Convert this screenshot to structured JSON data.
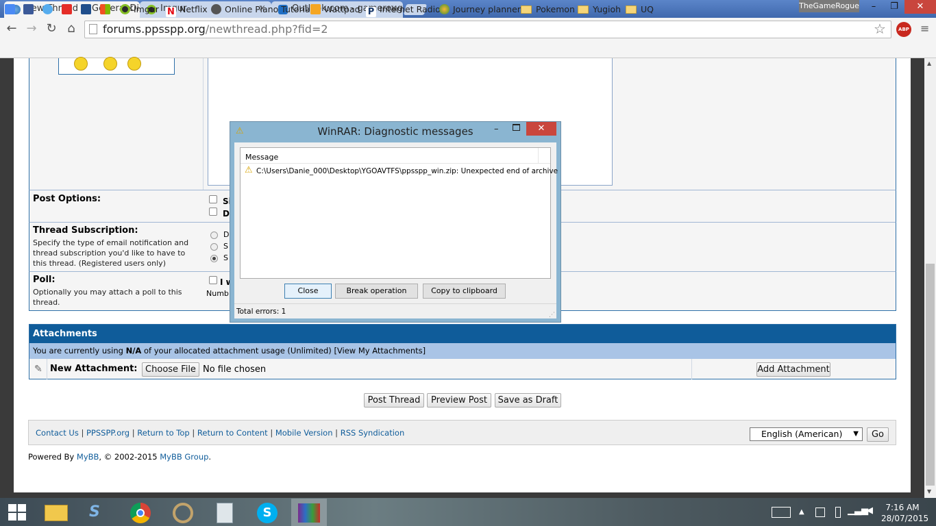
{
  "browser": {
    "tabs": [
      {
        "title": "New Thread in General Di",
        "close": "×"
      },
      {
        "title": "Imgur",
        "close": "×"
      },
      {
        "title": "Outlook.com - gamerougu",
        "close": "×"
      }
    ],
    "profile": "TheGameRogue",
    "window_controls": {
      "minimize": "–",
      "restore": "❐",
      "close": "✕"
    },
    "url_host": "forums.ppsspp.org",
    "url_path": "/newthread.php?fid=2",
    "abp_badge": "ABP",
    "bookmarks": [
      "Imgur",
      "Netflix",
      "Online Piano Tutorial",
      "Wattpad",
      "Internet Radio",
      "Journey planner",
      "Pokemon",
      "Yugioh",
      "UQ"
    ]
  },
  "form": {
    "post_options_label": "Post Options:",
    "post_options_items": [
      "Si",
      "D"
    ],
    "subscription_label": "Thread Subscription:",
    "subscription_desc": "Specify the type of email notification and thread subscription you'd like to have to this thread. (Registered users only)",
    "subscription_items": [
      "D",
      "S",
      "S"
    ],
    "poll_label": "Poll:",
    "poll_desc": "Optionally you may attach a poll to this thread.",
    "poll_check": "I w",
    "poll_number": "Numb"
  },
  "attachments": {
    "header": "Attachments",
    "usage_pre": "You are currently using ",
    "usage_value": "N/A",
    "usage_post": " of your allocated attachment usage (Unlimited) [View My Attachments]",
    "new_label": "New Attachment:",
    "choose_file": "Choose File",
    "no_file": "No file chosen",
    "add_button": "Add Attachment"
  },
  "actions": {
    "post": "Post Thread",
    "preview": "Preview Post",
    "draft": "Save as Draft"
  },
  "footer": {
    "links": [
      "Contact Us",
      "PPSSPP.org",
      "Return to Top",
      "Return to Content",
      "Mobile Version",
      "RSS Syndication"
    ],
    "separator": "|",
    "language": "English (American)",
    "go": "Go",
    "powered_pre": "Powered By ",
    "mybb": "MyBB",
    "powered_mid": ", © 2002-2015 ",
    "mybb_group": "MyBB Group",
    "powered_end": "."
  },
  "dialog": {
    "title": "WinRAR: Diagnostic messages",
    "column": "Message",
    "message": "C:\\Users\\Danie_000\\Desktop\\YGOAVTFS\\ppsspp_win.zip: Unexpected end of archive",
    "buttons": [
      "Close",
      "Break operation",
      "Copy to clipboard"
    ],
    "total_errors": "Total errors: 1"
  },
  "taskbar": {
    "time": "7:16 AM",
    "date": "28/07/2015"
  },
  "colors": {
    "forum_blue": "#0f5c9a",
    "light_blue": "#a9c4e6",
    "chrome_blue": "#4a71b5",
    "dialog_frame": "#8ab5d1"
  }
}
